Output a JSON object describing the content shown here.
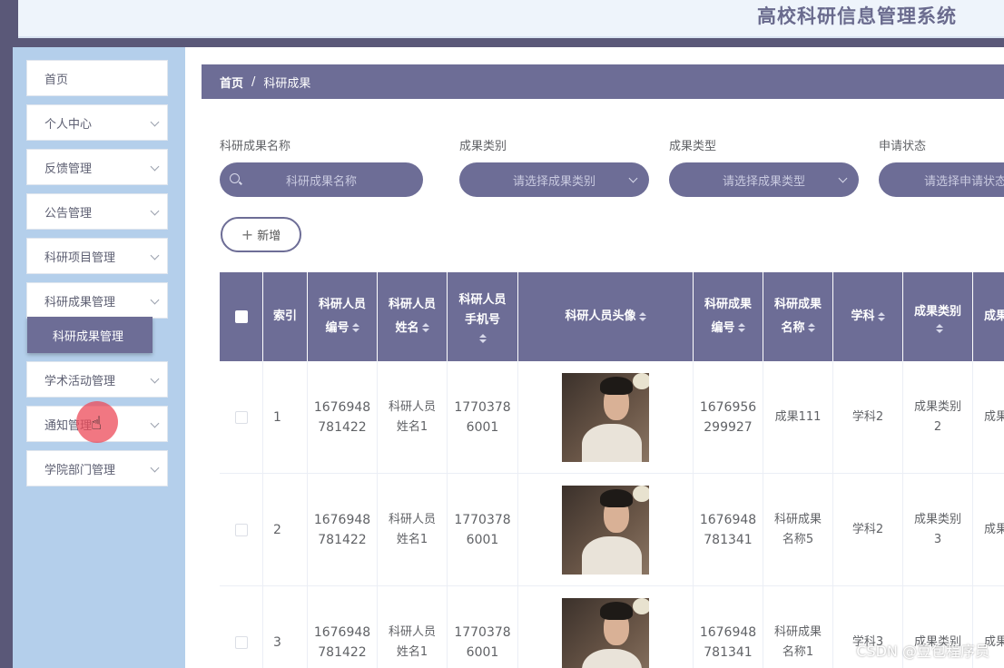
{
  "app": {
    "title": "高校科研信息管理系统"
  },
  "sidebar": {
    "items": [
      {
        "label": "首页",
        "has_arrow": false
      },
      {
        "label": "个人中心",
        "has_arrow": true
      },
      {
        "label": "反馈管理",
        "has_arrow": true
      },
      {
        "label": "公告管理",
        "has_arrow": true
      },
      {
        "label": "科研项目管理",
        "has_arrow": true
      },
      {
        "label": "科研成果管理",
        "has_arrow": true
      },
      {
        "label": "学术活动管理",
        "has_arrow": true
      },
      {
        "label": "通知管理",
        "has_arrow": true
      },
      {
        "label": "学院部门管理",
        "has_arrow": true
      }
    ],
    "submenu": {
      "label": "科研成果管理"
    }
  },
  "breadcrumb": {
    "home": "首页",
    "separator": "/",
    "current": "科研成果"
  },
  "filters": [
    {
      "label": "科研成果名称",
      "placeholder": "科研成果名称",
      "icon": "search-icon"
    },
    {
      "label": "成果类别",
      "placeholder": "请选择成果类别",
      "icon": "chevron-down-icon"
    },
    {
      "label": "成果类型",
      "placeholder": "请选择成果类型",
      "icon": "chevron-down-icon"
    },
    {
      "label": "申请状态",
      "placeholder": "请选择申请状态",
      "icon": "chevron-down-icon"
    }
  ],
  "actions": {
    "add_label": "新增",
    "add_icon": "+"
  },
  "table": {
    "columns": [
      {
        "key": "select",
        "line1": "",
        "line2": ""
      },
      {
        "key": "index",
        "line1": "索引",
        "line2": ""
      },
      {
        "key": "staff_no",
        "line1": "科研人员",
        "line2": "编号"
      },
      {
        "key": "staff_name",
        "line1": "科研人员",
        "line2": "姓名"
      },
      {
        "key": "phone",
        "line1": "科研人员",
        "line2": "手机号"
      },
      {
        "key": "avatar",
        "line1": "科研人员头像",
        "line2": ""
      },
      {
        "key": "result_no",
        "line1": "科研成果",
        "line2": "编号"
      },
      {
        "key": "result_name",
        "line1": "科研成果",
        "line2": "名称"
      },
      {
        "key": "subject",
        "line1": "学科",
        "line2": ""
      },
      {
        "key": "category",
        "line1": "成果类别",
        "line2": ""
      },
      {
        "key": "type",
        "line1": "成果",
        "line2": ""
      }
    ],
    "rows": [
      {
        "index": "1",
        "staff_no_1": "1676948",
        "staff_no_2": "781422",
        "name_1": "科研人员",
        "name_2": "姓名1",
        "phone_1": "1770378",
        "phone_2": "6001",
        "result_no_1": "1676956",
        "result_no_2": "299927",
        "result_name_1": "成果111",
        "result_name_2": "",
        "subject": "学科2",
        "cat_1": "成果类别",
        "cat_2": "2",
        "type": "成果"
      },
      {
        "index": "2",
        "staff_no_1": "1676948",
        "staff_no_2": "781422",
        "name_1": "科研人员",
        "name_2": "姓名1",
        "phone_1": "1770378",
        "phone_2": "6001",
        "result_no_1": "1676948",
        "result_no_2": "781341",
        "result_name_1": "科研成果",
        "result_name_2": "名称5",
        "subject": "学科2",
        "cat_1": "成果类别",
        "cat_2": "3",
        "type": "成果"
      },
      {
        "index": "3",
        "staff_no_1": "1676948",
        "staff_no_2": "781422",
        "name_1": "科研人员",
        "name_2": "姓名1",
        "phone_1": "1770378",
        "phone_2": "6001",
        "result_no_1": "1676948",
        "result_no_2": "781341",
        "result_name_1": "科研成果",
        "result_name_2": "名称1",
        "subject": "学科3",
        "cat_1": "成果类别",
        "cat_2": "",
        "type": "成果"
      }
    ]
  },
  "watermark": "CSDN @豆包程序员",
  "colors": {
    "accent": "#6d6d96",
    "sidebar_bg": "#b4cfeb",
    "header_bg": "#eef4fb",
    "title_color": "#6a6b8e",
    "click_indicator": "#ec4a58"
  }
}
